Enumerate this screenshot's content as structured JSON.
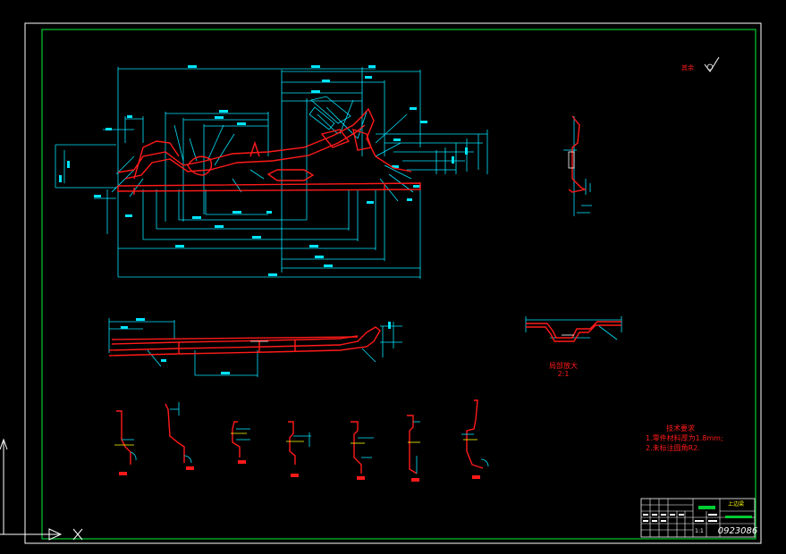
{
  "drawing": {
    "background": "#000000",
    "colors": {
      "frame": "#00cc33",
      "dimension": "#00e5ff",
      "part": "#ff1a1a",
      "white": "#ffffff",
      "title_block_text": "#ffffff"
    },
    "roughness_note": "其余",
    "detail_view": {
      "label": "局部放大",
      "scale": "2:1"
    },
    "technical_requirements": {
      "title": "技术要求",
      "items": [
        "1.零件材料厚为1.8mm;",
        "2.未标注圆角R2."
      ]
    },
    "title_block": {
      "part_name": "上边梁",
      "drawing_number": "0923086",
      "scale_text": "1:1"
    },
    "dimension_values": [
      "2460",
      "1340",
      "1210",
      "540",
      "458",
      "320",
      "220",
      "180",
      "1500",
      "2150",
      "2000",
      "600",
      "370",
      "90",
      "50",
      "40",
      "R15",
      "R20"
    ]
  }
}
